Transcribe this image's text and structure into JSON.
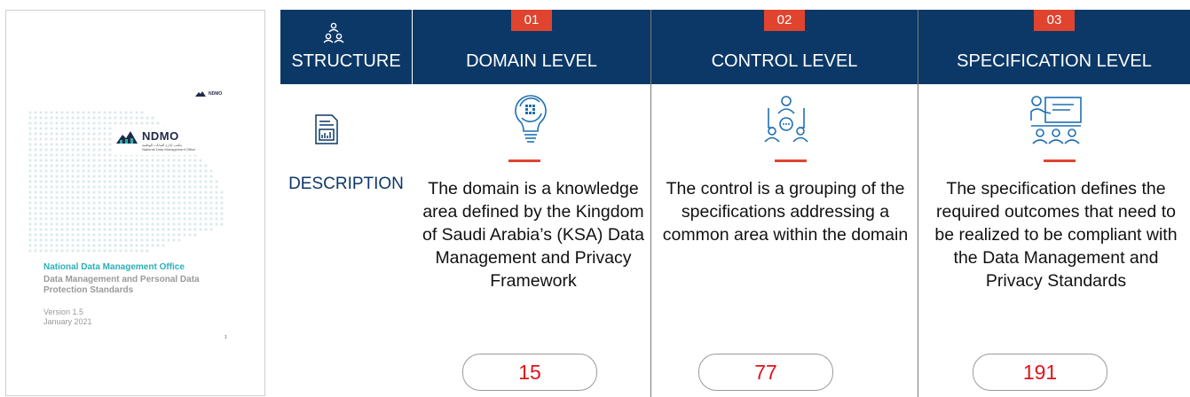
{
  "cover": {
    "small_logo": "NDMO",
    "logo_name": "NDMO",
    "logo_arabic": "مكتب إدارة البيانات الوطنية",
    "logo_sub": "National Data Management Office",
    "org": "National Data Management Office",
    "doc_title": "Data Management and Personal Data Protection Standards",
    "version": "Version 1.5",
    "date": "January 2021",
    "page_number": "1"
  },
  "structure": {
    "header": "STRUCTURE",
    "description_label": "DESCRIPTION"
  },
  "columns": [
    {
      "badge": "01",
      "title": "DOMAIN LEVEL",
      "icon": "lightbulb-gear-icon",
      "description": "The domain is a knowledge area defined by the Kingdom of Saudi Arabia’s (KSA) Data Management and Privacy Framework",
      "count": "15"
    },
    {
      "badge": "02",
      "title": "CONTROL LEVEL",
      "icon": "group-meeting-icon",
      "description": "The control is a grouping of the specifications addressing a common area within the domain",
      "count": "77"
    },
    {
      "badge": "03",
      "title": "SPECIFICATION LEVEL",
      "icon": "presentation-board-icon",
      "description": "The specification defines the required outcomes that need to be realized to be compliant with the Data Management and Privacy Standards",
      "count": "191"
    }
  ],
  "colors": {
    "header_navy": "#0c3867",
    "accent_red": "#e0442f",
    "icon_blue": "#1f6fb2",
    "count_red": "#e0131a",
    "teal": "#2ab0b6"
  }
}
